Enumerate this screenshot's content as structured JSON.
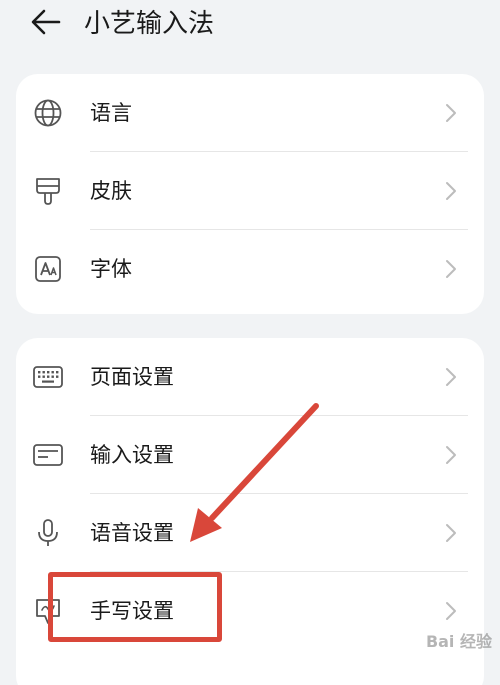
{
  "header": {
    "title": "小艺输入法",
    "back_icon": "arrow-left-icon"
  },
  "groups": [
    {
      "items": [
        {
          "label": "语言",
          "icon": "globe-icon"
        },
        {
          "label": "皮肤",
          "icon": "paintbrush-icon"
        },
        {
          "label": "字体",
          "icon": "font-icon"
        }
      ]
    },
    {
      "items": [
        {
          "label": "页面设置",
          "icon": "keyboard-icon"
        },
        {
          "label": "输入设置",
          "icon": "input-card-icon"
        },
        {
          "label": "语音设置",
          "icon": "microphone-icon"
        },
        {
          "label": "手写设置",
          "icon": "handwriting-icon"
        }
      ]
    }
  ],
  "annotation": {
    "highlighted_item": "手写设置",
    "color": "#d9473a"
  },
  "watermark": {
    "text": "Bai 经验"
  }
}
